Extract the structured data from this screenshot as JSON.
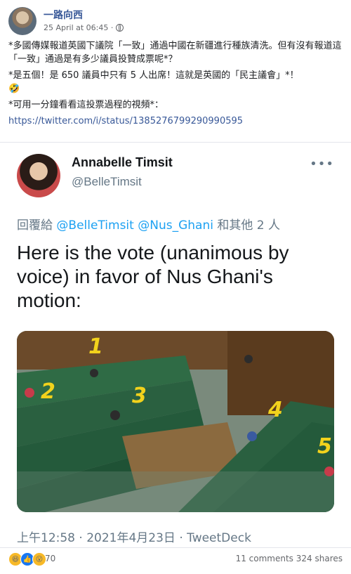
{
  "post": {
    "author": "一路向西",
    "timestamp": "25 April at 06:45 · ",
    "paragraph1": "*多國傳媒報道英國下議院「一致」通過中國在新疆進行種族清洗。但有沒有報道這「一致」通過是有多少議員投贊成票呢*？",
    "paragraph2": "*是五個！是 650 議員中只有 5 人出席！這就是英國的「民主議會」*！",
    "paragraph2_emoji": "🤣",
    "paragraph3": "*可用一分鐘看看這投票過程的視頻*：",
    "link": "https://twitter.com/i/status/1385276799290990595"
  },
  "tweet": {
    "name": "Annabelle Timsit",
    "handle": "@BelleTimsit",
    "more": "•••",
    "reply_prefix": "回覆給 ",
    "reply_mentions": "@BelleTimsit @Nus_Ghani",
    "reply_suffix": " 和其他 2 人",
    "text": "Here is the vote (unanimous by voice) in favor of Nus Ghani's motion:",
    "footer": "上午12:58 · 2021年4月23日 · TweetDeck",
    "media_numbers": [
      "1",
      "2",
      "3",
      "4",
      "5"
    ]
  },
  "reactions": {
    "count": "70",
    "comments": "11 comments",
    "shares": "324 shares"
  }
}
